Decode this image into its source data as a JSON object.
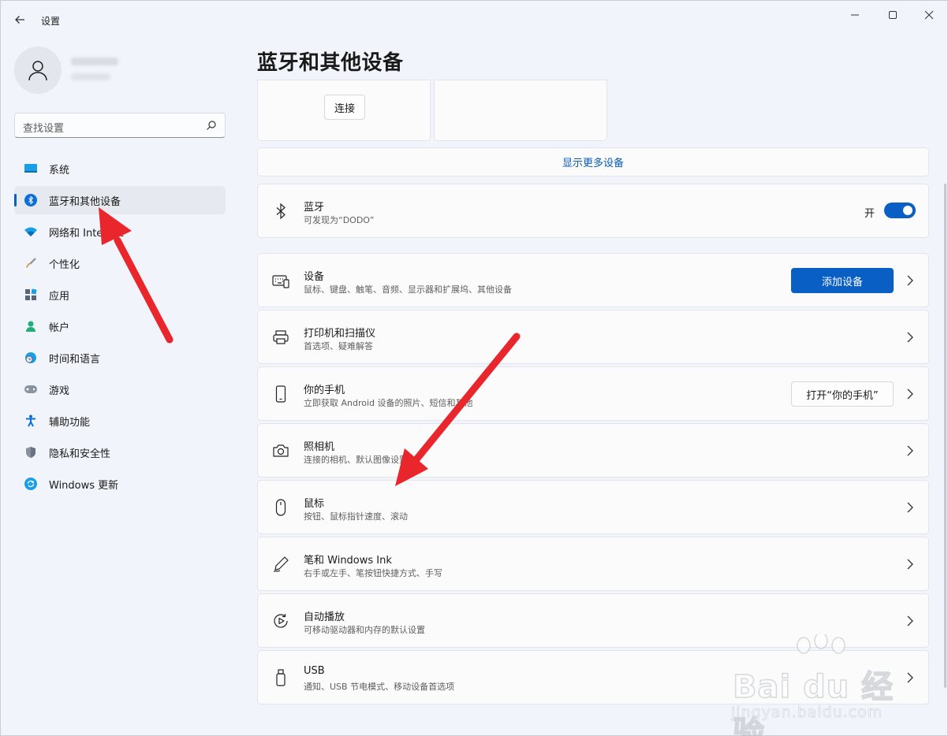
{
  "window": {
    "title": "设置",
    "back_icon": "arrow-left-icon"
  },
  "sidebar": {
    "search_placeholder": "查找设置",
    "items": [
      {
        "label": "系统",
        "icon": "monitor-icon",
        "color": "#0f8bd9",
        "active": false
      },
      {
        "label": "蓝牙和其他设备",
        "icon": "bluetooth-icon",
        "color": "#0a6fd6",
        "active": true
      },
      {
        "label": "网络和 Internet",
        "icon": "wifi-icon",
        "color": "#0f8bd9",
        "active": false
      },
      {
        "label": "个性化",
        "icon": "brush-icon",
        "color": "#d98a2b",
        "active": false
      },
      {
        "label": "应用",
        "icon": "apps-icon",
        "color": "#4a5568",
        "active": false
      },
      {
        "label": "帐户",
        "icon": "user-icon",
        "color": "#1fae7a",
        "active": false
      },
      {
        "label": "时间和语言",
        "icon": "clock-globe-icon",
        "color": "#0f8bd9",
        "active": false
      },
      {
        "label": "游戏",
        "icon": "gamepad-icon",
        "color": "#7c8592",
        "active": false
      },
      {
        "label": "辅助功能",
        "icon": "accessibility-icon",
        "color": "#0a6fd6",
        "active": false
      },
      {
        "label": "隐私和安全性",
        "icon": "shield-icon",
        "color": "#7c8592",
        "active": false
      },
      {
        "label": "Windows 更新",
        "icon": "refresh-icon",
        "color": "#0f8bd9",
        "active": false
      }
    ]
  },
  "main": {
    "title": "蓝牙和其他设备",
    "connect_label": "连接",
    "show_more_label": "显示更多设备",
    "bluetooth": {
      "title": "蓝牙",
      "subtitle": "可发现为“DODO”",
      "toggle_label": "开",
      "on": true
    },
    "rows": [
      {
        "title": "设备",
        "subtitle": "鼠标、键盘、触笔、音频、显示器和扩展坞、其他设备",
        "icon": "keyboard-devices-icon",
        "button": "添加设备",
        "button_style": "primary"
      },
      {
        "title": "打印机和扫描仪",
        "subtitle": "首选项、疑难解答",
        "icon": "printer-icon"
      },
      {
        "title": "你的手机",
        "subtitle": "立即获取 Android 设备的照片、短信和其他",
        "icon": "phone-icon",
        "button": "打开“你的手机”",
        "button_style": "secondary"
      },
      {
        "title": "照相机",
        "subtitle": "连接的相机、默认图像设置",
        "icon": "camera-icon"
      },
      {
        "title": "鼠标",
        "subtitle": "按钮、鼠标指针速度、滚动",
        "icon": "mouse-icon"
      },
      {
        "title": "笔和 Windows Ink",
        "subtitle": "右手或左手、笔按钮快捷方式、手写",
        "icon": "pen-icon"
      },
      {
        "title": "自动播放",
        "subtitle": "可移动驱动器和内存的默认设置",
        "icon": "autoplay-icon"
      },
      {
        "title": "USB",
        "subtitle": "通知、USB 节电模式、移动设备首选项",
        "icon": "usb-icon"
      }
    ]
  },
  "watermark": {
    "brand": "Bai du 经验",
    "url": "jingyan.baidu.com"
  },
  "accent_color": "#0a5fc4",
  "annotation_color": "#e8262b"
}
